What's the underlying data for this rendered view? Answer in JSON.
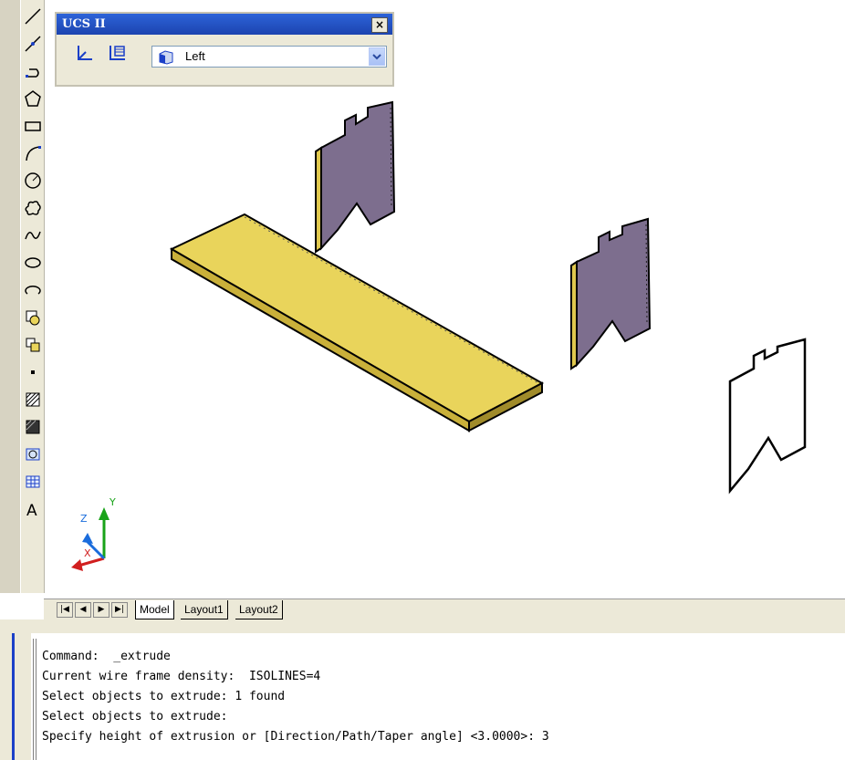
{
  "ucs_panel": {
    "title": "UCS II",
    "close_label": "×",
    "selected_view": "Left"
  },
  "tabs": {
    "model": "Model",
    "layout1": "Layout1",
    "layout2": "Layout2"
  },
  "ucs_icon": {
    "x_label": "X",
    "y_label": "Y",
    "z_label": "Z"
  },
  "command_history": [
    "Command:  _extrude",
    "Current wire frame density:  ISOLINES=4",
    "Select objects to extrude: 1 found",
    "Select objects to extrude:",
    "Specify height of extrusion or [Direction/Path/Taper angle] <3.0000>: 3"
  ],
  "toolbar_icons": [
    "line-icon",
    "construction-line-icon",
    "polyline-icon",
    "polygon-icon",
    "rectangle-icon",
    "arc-icon",
    "circle-icon",
    "revision-cloud-icon",
    "spline-icon",
    "ellipse-icon",
    "ellipse-arc-icon",
    "insert-block-icon",
    "make-block-icon",
    "point-icon",
    "hatch-icon",
    "gradient-icon",
    "region-icon",
    "table-icon",
    "multiline-text-icon"
  ],
  "colors": {
    "shelf_top": "#e9d45b",
    "shelf_side": "#c9b03a",
    "panel_face": "#7d6e8e",
    "panel_edge": "#e0c84e",
    "title_bar": "#1f4bc0"
  }
}
